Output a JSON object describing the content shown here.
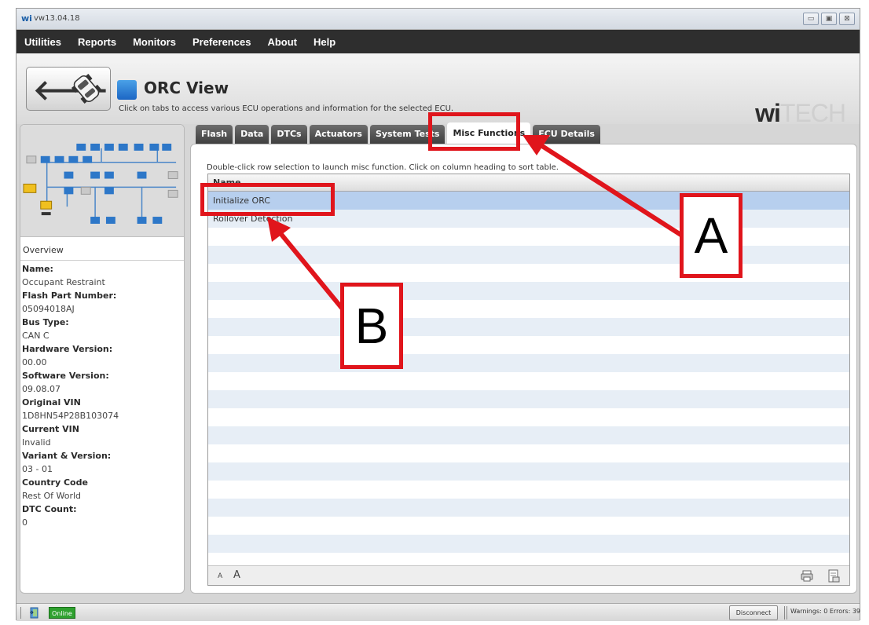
{
  "window": {
    "title": "vw13.04.18",
    "logo_text": "wi",
    "controls": [
      "▭",
      "▣",
      "⊠"
    ]
  },
  "menu": [
    "Utilities",
    "Reports",
    "Monitors",
    "Preferences",
    "About",
    "Help"
  ],
  "header": {
    "title": "ORC View",
    "subtitle": "Click on tabs to access various ECU operations and information for the selected ECU.",
    "back_arrow": "🡐",
    "brand_wi": "wi",
    "brand_tech": "TECH"
  },
  "sidebar": {
    "overview_label": "Overview",
    "fields": [
      {
        "label": "Name:",
        "value": "Occupant Restraint"
      },
      {
        "label": "Flash Part Number:",
        "value": "05094018AJ"
      },
      {
        "label": "Bus Type:",
        "value": "CAN C"
      },
      {
        "label": "Hardware Version:",
        "value": "00.00"
      },
      {
        "label": "Software Version:",
        "value": "09.08.07"
      },
      {
        "label": "Original VIN",
        "value": "1D8HN54P28B103074"
      },
      {
        "label": "Current VIN",
        "value": "Invalid"
      },
      {
        "label": "Variant & Version:",
        "value": "03 - 01"
      },
      {
        "label": "Country Code",
        "value": "Rest Of World"
      },
      {
        "label": "DTC Count:",
        "value": "0"
      }
    ]
  },
  "tabs": [
    {
      "label": "Flash",
      "active": false
    },
    {
      "label": "Data",
      "active": false
    },
    {
      "label": "DTCs",
      "active": false
    },
    {
      "label": "Actuators",
      "active": false
    },
    {
      "label": "System Tests",
      "active": false
    },
    {
      "label": "Misc Functions",
      "active": true
    },
    {
      "label": "ECU Details",
      "active": false
    }
  ],
  "main": {
    "instructions": "Double-click row selection to launch misc function.  Click on column heading to sort table.",
    "column_header": "Name",
    "rows": [
      "Initialize ORC",
      "Rollover Detection"
    ],
    "font_small": "A",
    "font_large": "A"
  },
  "status": {
    "online": "Online",
    "disconnect": "Disconnect",
    "warnings": "Warnings: 0 Errors: 39"
  },
  "annotations": [
    "A",
    "B"
  ],
  "colors": {
    "annotation_red": "#e0151c",
    "selected_row": "#b7cfee",
    "online_green": "#2fa12f"
  }
}
